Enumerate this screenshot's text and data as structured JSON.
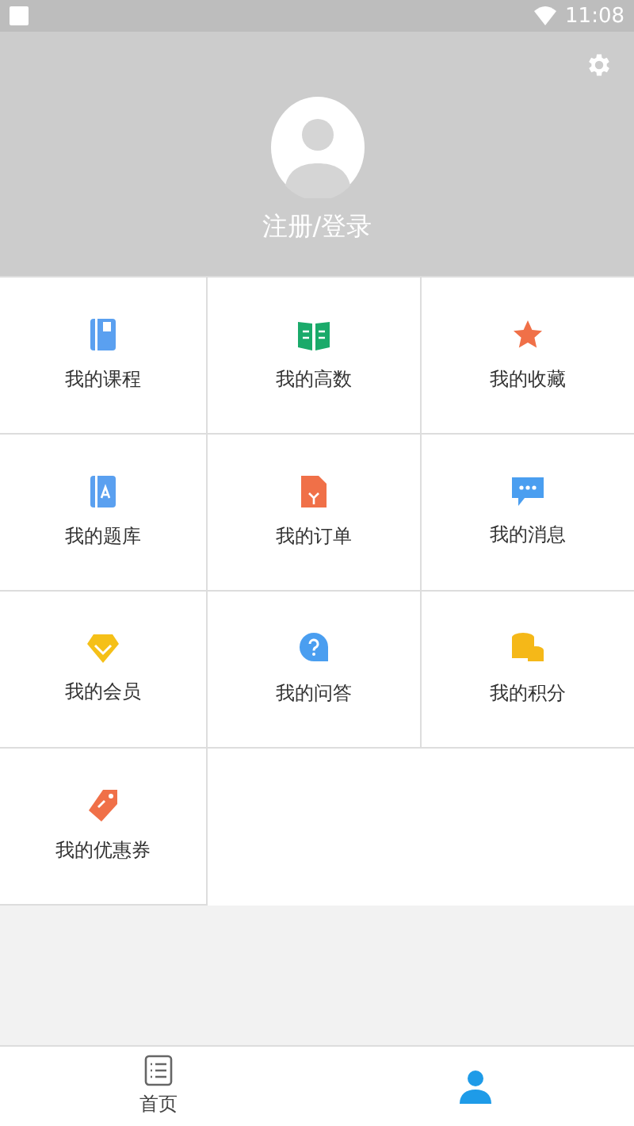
{
  "status_bar": {
    "time": "11:08"
  },
  "profile": {
    "login_label": "注册/登录"
  },
  "menu": [
    {
      "label": "我的课程"
    },
    {
      "label": "我的高数"
    },
    {
      "label": "我的收藏"
    },
    {
      "label": "我的题库"
    },
    {
      "label": "我的订单"
    },
    {
      "label": "我的消息"
    },
    {
      "label": "我的会员"
    },
    {
      "label": "我的问答"
    },
    {
      "label": "我的积分"
    },
    {
      "label": "我的优惠券"
    }
  ],
  "tabs": [
    {
      "label": "首页",
      "selected": false
    },
    {
      "selected": true
    }
  ]
}
